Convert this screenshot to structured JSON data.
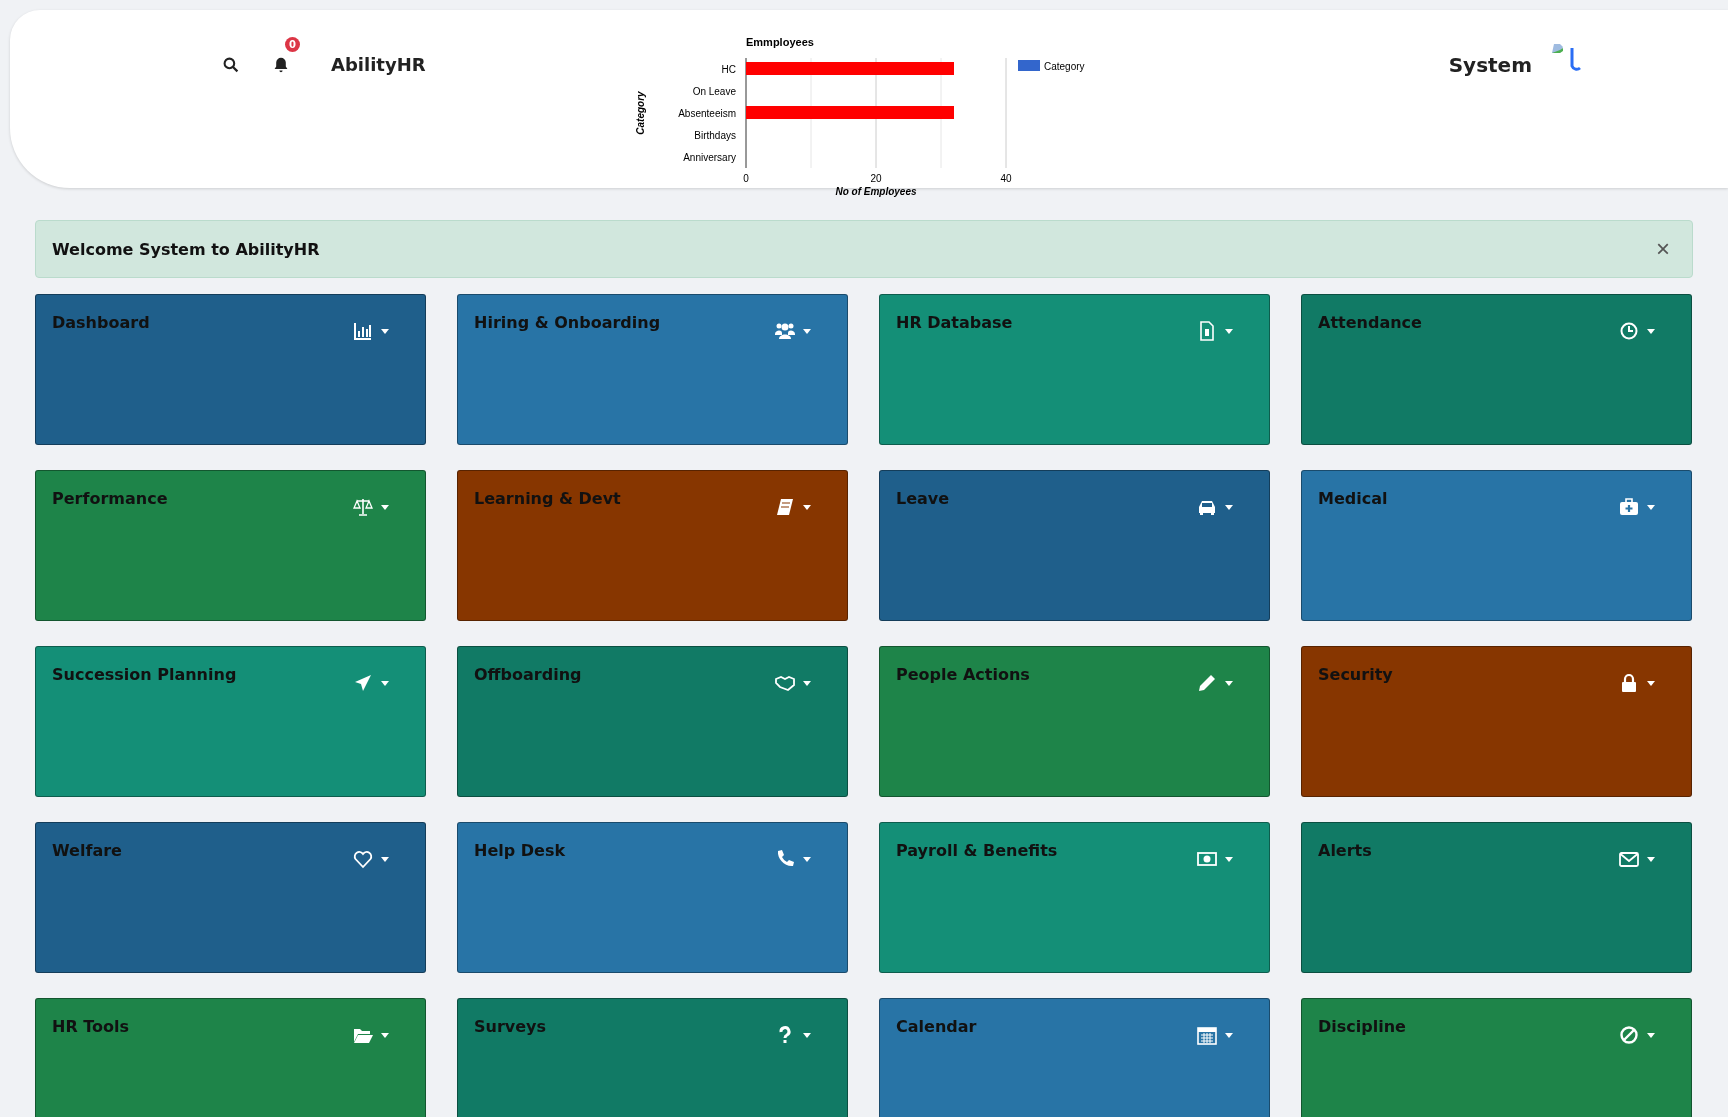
{
  "header": {
    "notification_count": "0",
    "app_name": "AbilityHR",
    "user_name": "System"
  },
  "chart": {
    "chart_data": {
      "type": "bar",
      "orientation": "horizontal",
      "title": "Emmployees",
      "xlabel": "No of Employees",
      "ylabel": "Category",
      "categories": [
        "HC",
        "On Leave",
        "Absenteeism",
        "Birthdays",
        "Anniversary"
      ],
      "series": [
        {
          "name": "Category",
          "color": "#ff0000",
          "values": [
            32,
            0,
            32,
            0,
            0
          ]
        }
      ],
      "xlim": [
        0,
        40
      ],
      "xticks": [
        0,
        20,
        40
      ],
      "ref_lines": [
        {
          "axis": "x",
          "value": 10
        },
        {
          "axis": "x",
          "value": 30
        }
      ]
    }
  },
  "alert": {
    "message": "Welcome System to AbilityHR",
    "close": "×"
  },
  "tiles": [
    {
      "title": "Dashboard",
      "color": "#1f5f8b"
    },
    {
      "title": "Hiring & Onboarding",
      "color": "#2874a6"
    },
    {
      "title": "HR Database",
      "color": "#148f77"
    },
    {
      "title": "Attendance",
      "color": "#117a65"
    },
    {
      "title": "Performance",
      "color": "#1e8449"
    },
    {
      "title": "Learning & Devt",
      "color": "#873600"
    },
    {
      "title": "Leave",
      "color": "#1f5f8b"
    },
    {
      "title": "Medical",
      "color": "#2874a6"
    },
    {
      "title": "Succession Planning",
      "color": "#148f77"
    },
    {
      "title": "Offboarding",
      "color": "#117a65"
    },
    {
      "title": "People Actions",
      "color": "#1e8449"
    },
    {
      "title": "Security",
      "color": "#873600"
    },
    {
      "title": "Welfare",
      "color": "#1f5f8b"
    },
    {
      "title": "Help Desk",
      "color": "#2874a6"
    },
    {
      "title": "Payroll & Benefits",
      "color": "#148f77"
    },
    {
      "title": "Alerts",
      "color": "#117a65"
    },
    {
      "title": "HR Tools",
      "color": "#1e8449"
    },
    {
      "title": "Surveys",
      "color": "#117a65"
    },
    {
      "title": "Calendar",
      "color": "#2874a6"
    },
    {
      "title": "Discipline",
      "color": "#1e8449"
    }
  ]
}
